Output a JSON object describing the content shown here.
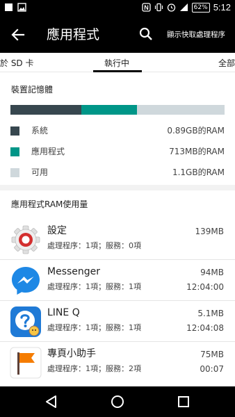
{
  "status_bar": {
    "battery": "62%",
    "time": "5:12"
  },
  "header": {
    "title": "應用程式",
    "show_cached_label": "顯示快取處理程序"
  },
  "tabs": {
    "sd_card": "於 SD 卡",
    "running": "執行中",
    "all": "全部"
  },
  "memory": {
    "header": "裝置記憶體",
    "bar": [
      {
        "name": "系統",
        "fraction": 0.33,
        "color": "#37474f"
      },
      {
        "name": "應用程式",
        "fraction": 0.26,
        "color": "#009688"
      },
      {
        "name": "可用",
        "fraction": 0.41,
        "color": "#cfd8dc"
      }
    ],
    "legend": [
      {
        "label": "系統",
        "value": "0.89GB的RAM",
        "color": "#37474f"
      },
      {
        "label": "應用程式",
        "value": "713MB的RAM",
        "color": "#009688"
      },
      {
        "label": "可用",
        "value": "1.1GB的RAM",
        "color": "#cfd8dc"
      }
    ]
  },
  "app_usage": {
    "header": "應用程式RAM使用量",
    "apps": [
      {
        "name": "設定",
        "detail": "處理程序：1項；服務：0項",
        "memory": "139MB",
        "time": "",
        "icon": "settings-icon"
      },
      {
        "name": "Messenger",
        "detail": "處理程序：1項；服務：1項",
        "memory": "94MB",
        "time": "12:04:00",
        "icon": "messenger-icon"
      },
      {
        "name": "LINE Q",
        "detail": "處理程序：1項；服務：1項",
        "memory": "5.1MB",
        "time": "12:04:08",
        "icon": "line-q-icon"
      },
      {
        "name": "專頁小助手",
        "detail": "處理程序：1項；服務：2項",
        "memory": "75MB",
        "time": "00:07",
        "icon": "pages-manager-icon"
      }
    ]
  },
  "colors": {
    "system": "#37474f",
    "apps": "#009688",
    "free": "#cfd8dc",
    "messenger_blue": "#1e88e5",
    "line_q_blue": "#1f7ad6",
    "pages_orange": "#f57c00"
  }
}
